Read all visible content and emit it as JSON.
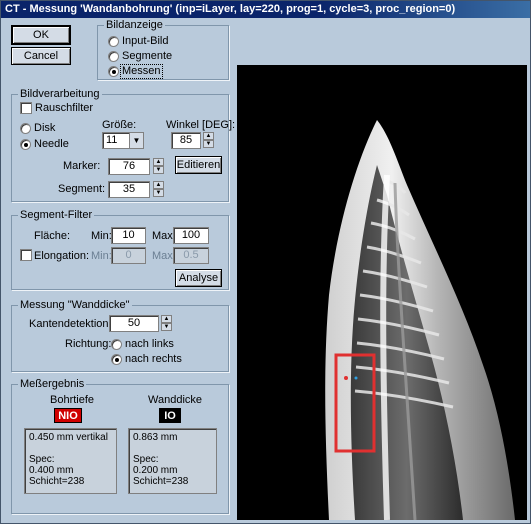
{
  "window": {
    "title": "CT - Messung 'Wandanbohrung'  (inp=iLayer, lay=220, prog=1, cycle=3, proc_region=0)"
  },
  "buttons": {
    "ok": "OK",
    "cancel": "Cancel",
    "edit": "Editieren",
    "analyse": "Analyse"
  },
  "bildanzeige": {
    "label": "Bildanzeige",
    "options": [
      "Input-Bild",
      "Segmente",
      "Messen"
    ],
    "selected": "Messen"
  },
  "bildverarbeitung": {
    "label": "Bildverarbeitung",
    "noise_filter": "Rauschfilter",
    "noise_filter_checked": false,
    "disk": "Disk",
    "needle": "Needle",
    "shape_selected": "Needle",
    "size_label": "Größe:",
    "size_value": "11",
    "angle_label": "Winkel [DEG]:",
    "angle_value": "85",
    "marker_label": "Marker:",
    "marker_value": "76",
    "segment_label": "Segment:",
    "segment_value": "35"
  },
  "segment_filter": {
    "label": "Segment-Filter",
    "area_label": "Fläche:",
    "min_label": "Min:",
    "max_label": "Max:",
    "area_min": "10",
    "area_max": "100",
    "elongation_label": "Elongation:",
    "elongation_checked": false,
    "elong_min_label": "Min:",
    "elong_max_label": "Max:",
    "elong_min": "0",
    "elong_max": "0.5"
  },
  "messung": {
    "label": "Messung \"Wanddicke\"",
    "edge_detection_label": "Kantendetektion:",
    "edge_detection_value": "50",
    "direction_label": "Richtung:",
    "left": "nach links",
    "right": "nach rechts",
    "direction_selected": "nach rechts"
  },
  "messergebnis": {
    "label": "Meßergebnis",
    "bohrtiefe_label": "Bohrtiefe",
    "bohrtiefe_badge": "NIO",
    "wanddicke_label": "Wanddicke",
    "wanddicke_badge": "IO",
    "bohrtiefe_text": "0.450 mm vertikal\n\nSpec:\n0.400 mm\nSchicht=238",
    "wanddicke_text": "0.863 mm\n\nSpec:\n0.200 mm\nSchicht=238"
  },
  "colors": {
    "nio_bg": "#d00000",
    "nio_text": "#ffffff",
    "io_bg": "#000000",
    "io_text": "#ffffff",
    "roi": "#e03030"
  }
}
